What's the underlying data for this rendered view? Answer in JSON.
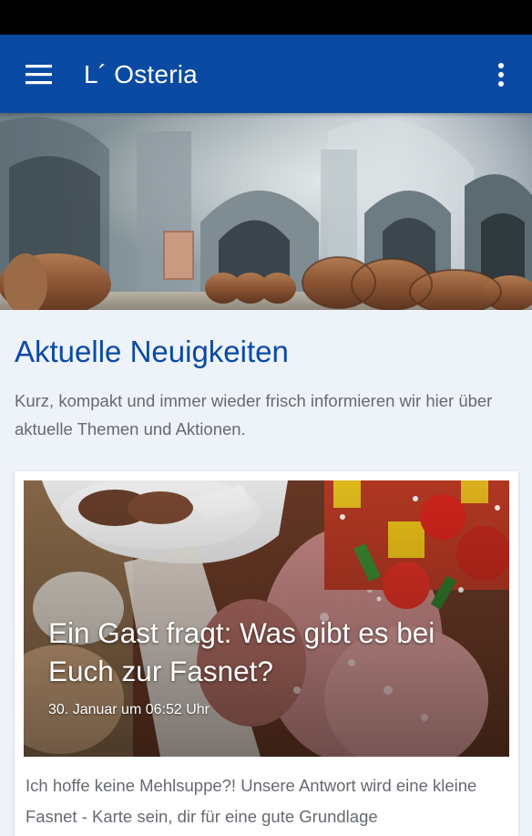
{
  "app_bar": {
    "title": "L´ Osteria",
    "background_color": "#0a4aa3",
    "left_icon": "hamburger-menu-icon",
    "right_icon": "overflow-menu-icon"
  },
  "news_section": {
    "heading": "Aktuelle Neuigkeiten",
    "intro": "Kurz, kompakt und immer wieder frisch informieren wir hier über aktuelle Themen und Aktionen.",
    "articles": [
      {
        "title": "Ein Gast fragt: Was gibt es bei Euch zur Fasnet?",
        "date": "30. Januar um 06:52 Uhr",
        "teaser": "Ich hoffe keine Mehlsuppe?! Unsere Antwort wird eine kleine Fasnet - Karte sein, dir für eine gute Grundlage"
      }
    ]
  },
  "colors": {
    "accent": "#0a4aa3",
    "page_background": "#eef2f9",
    "body_text": "#666a70"
  }
}
